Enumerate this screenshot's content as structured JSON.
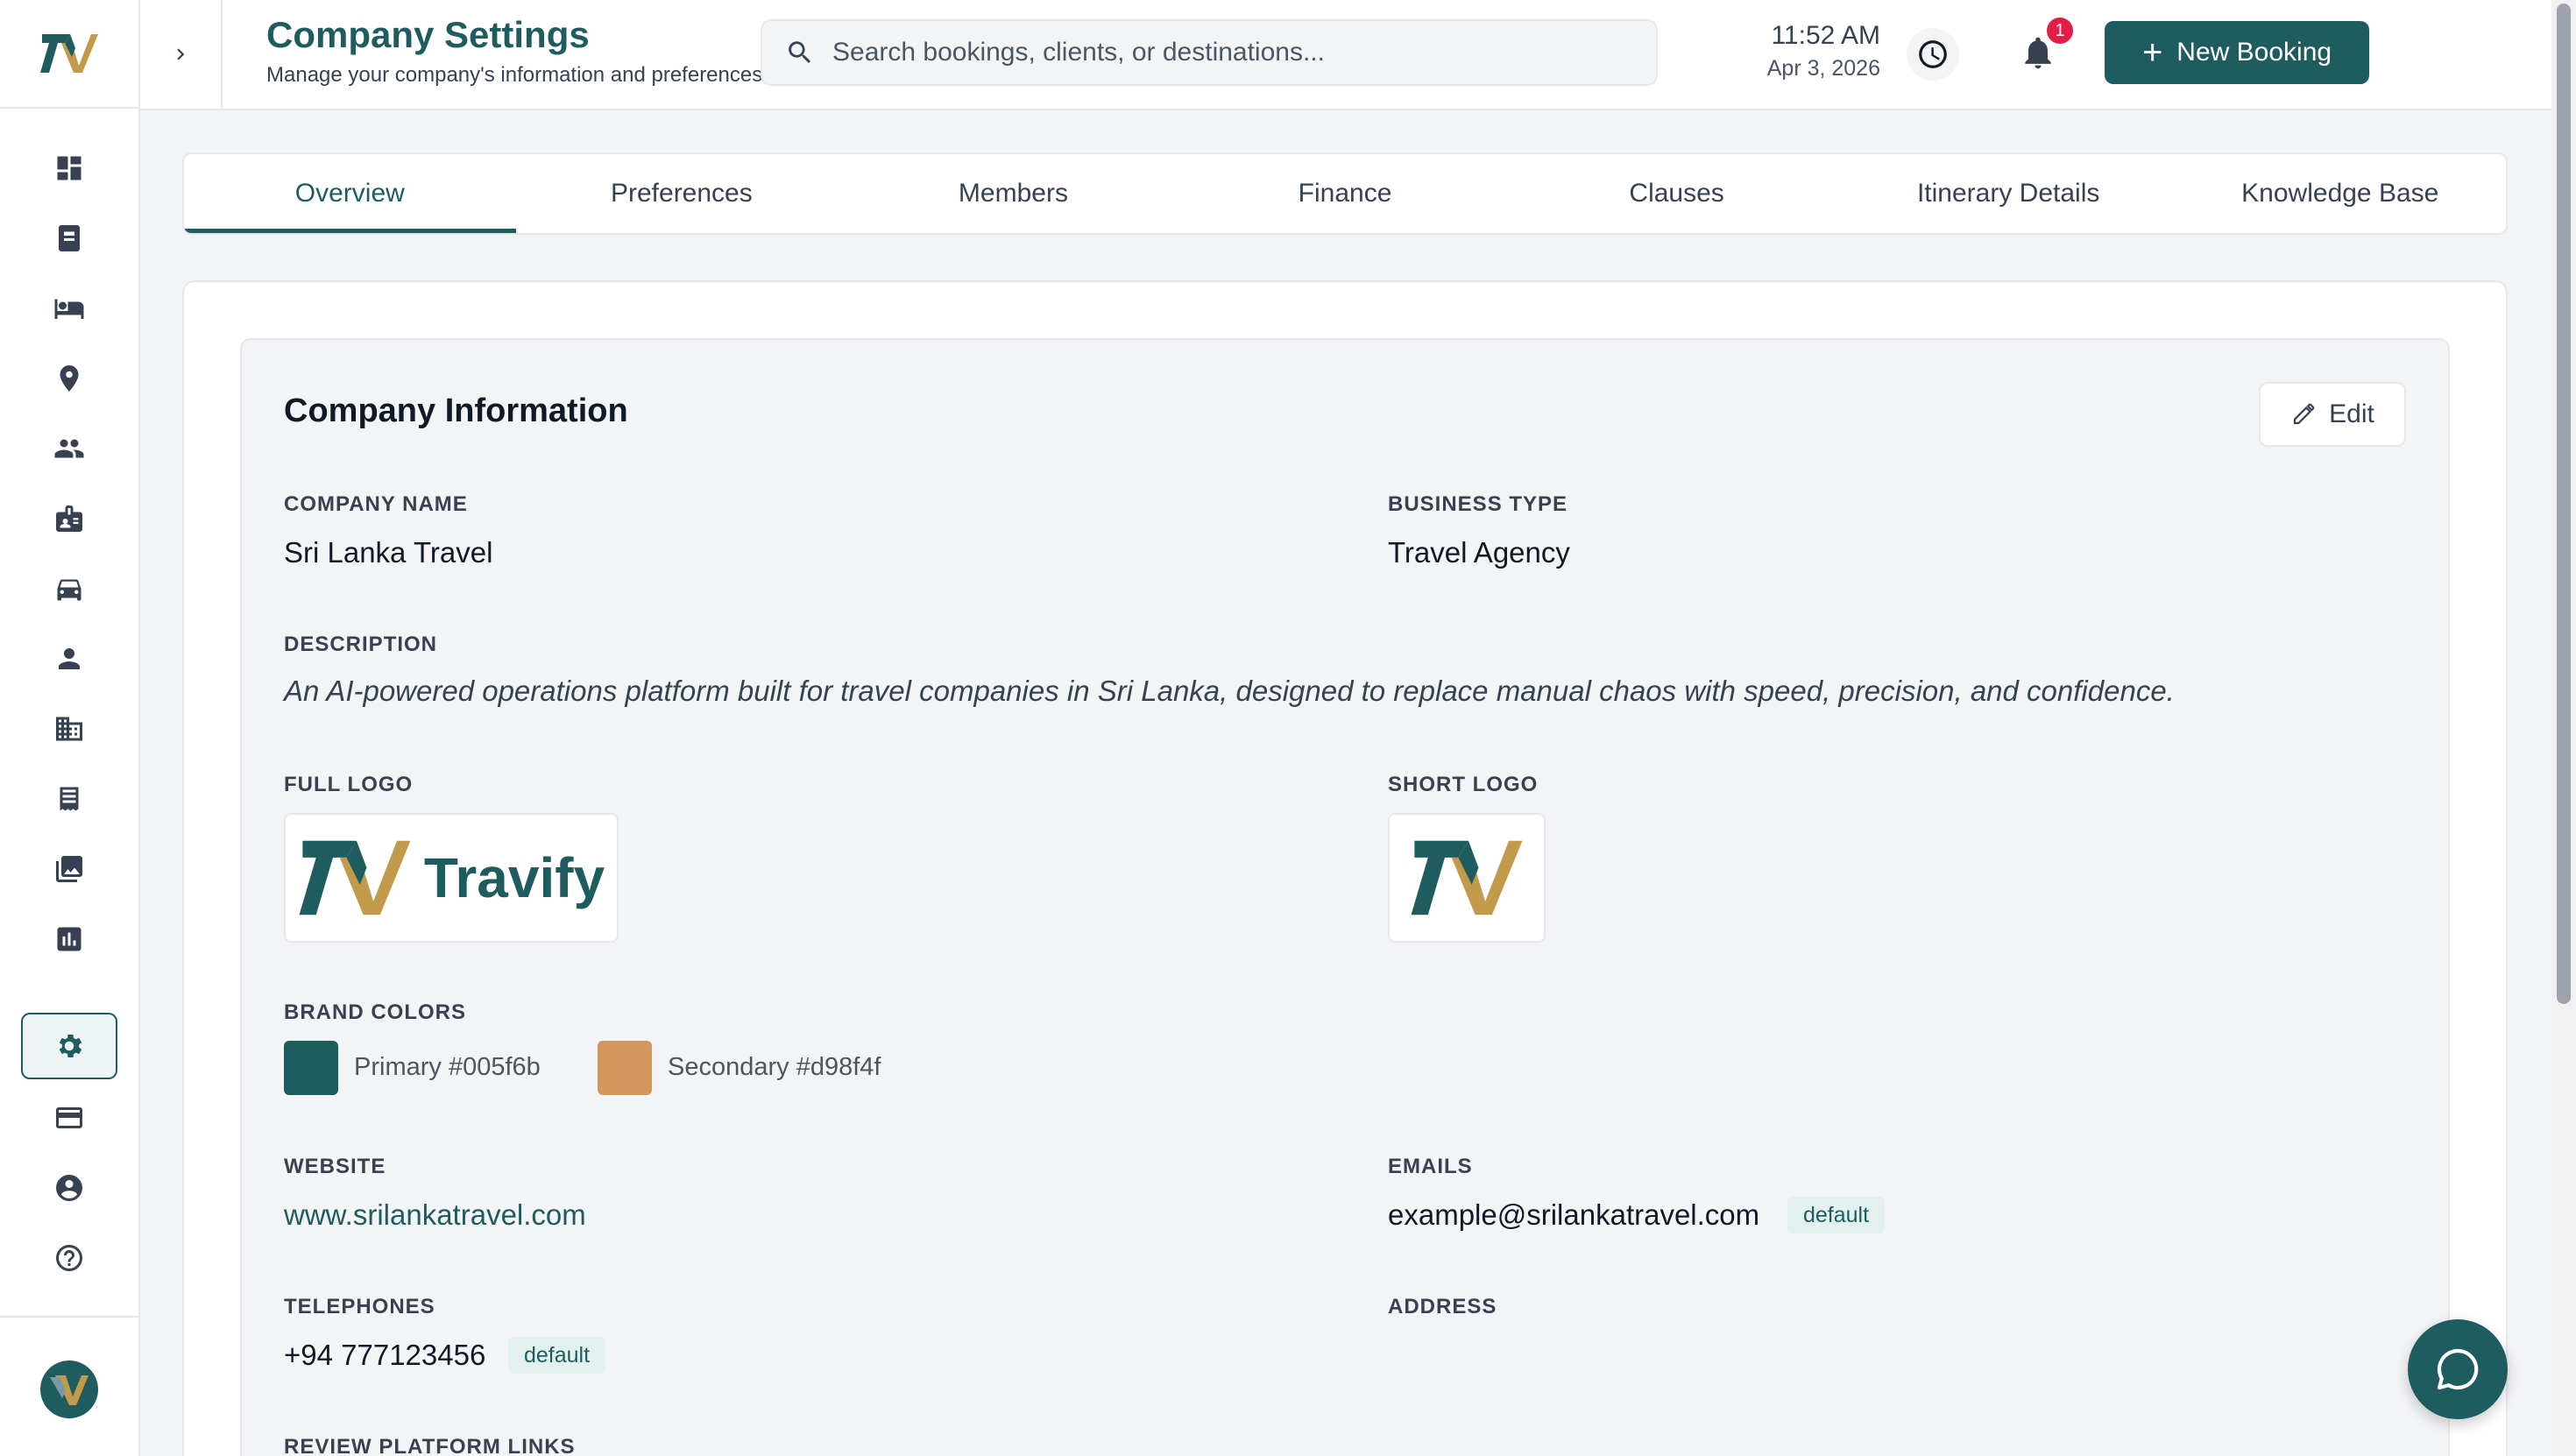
{
  "header": {
    "title": "Company Settings",
    "subtitle": "Manage your company's information and preferences.",
    "search_placeholder": "Search bookings, clients, or destinations...",
    "time": "11:52 AM",
    "date": "Apr 3, 2026",
    "notification_count": "1",
    "new_booking_label": "New Booking"
  },
  "sidebar": {
    "items": [
      {
        "name": "dashboard",
        "icon": "dashboard-icon"
      },
      {
        "name": "bookings",
        "icon": "booking-icon"
      },
      {
        "name": "hotels",
        "icon": "hotel-bed-icon"
      },
      {
        "name": "destinations",
        "icon": "location-pin-icon"
      },
      {
        "name": "clients",
        "icon": "people-icon"
      },
      {
        "name": "guides",
        "icon": "id-badge-icon"
      },
      {
        "name": "vehicles",
        "icon": "car-icon"
      },
      {
        "name": "users",
        "icon": "person-icon"
      },
      {
        "name": "companies",
        "icon": "building-icon"
      },
      {
        "name": "invoices",
        "icon": "receipt-icon"
      },
      {
        "name": "gallery",
        "icon": "photo-library-icon"
      },
      {
        "name": "reports",
        "icon": "bar-chart-icon"
      },
      {
        "name": "settings",
        "icon": "gear-icon",
        "active": true
      },
      {
        "name": "billing",
        "icon": "credit-card-icon"
      },
      {
        "name": "account",
        "icon": "account-circle-icon"
      },
      {
        "name": "help",
        "icon": "help-icon"
      }
    ]
  },
  "tabs": [
    "Overview",
    "Preferences",
    "Members",
    "Finance",
    "Clauses",
    "Itinerary Details",
    "Knowledge Base"
  ],
  "active_tab": "Overview",
  "company": {
    "section_title": "Company Information",
    "edit_label": "Edit",
    "company_name_label": "COMPANY NAME",
    "company_name": "Sri Lanka Travel",
    "business_type_label": "BUSINESS TYPE",
    "business_type": "Travel Agency",
    "description_label": "DESCRIPTION",
    "description": "An AI-powered operations platform built for travel companies in Sri Lanka, designed to replace manual chaos with speed, precision, and confidence.",
    "full_logo_label": "FULL LOGO",
    "full_logo_text": "Travify",
    "short_logo_label": "SHORT LOGO",
    "brand_colors_label": "BRAND COLORS",
    "primary_label": "Primary #005f6b",
    "primary_color": "#1f5c5f",
    "secondary_label": "Secondary #d98f4f",
    "secondary_color": "#d3975c",
    "website_label": "WEBSITE",
    "website": "www.srilankatravel.com",
    "emails_label": "EMAILS",
    "email": "example@srilankatravel.com",
    "email_tag": "default",
    "telephones_label": "TELEPHONES",
    "telephone": "+94 777123456",
    "telephone_tag": "default",
    "address_label": "ADDRESS",
    "review_links_label": "REVIEW PLATFORM LINKS"
  },
  "colors": {
    "accent": "#1f5c5f",
    "gold": "#c29a4a"
  }
}
